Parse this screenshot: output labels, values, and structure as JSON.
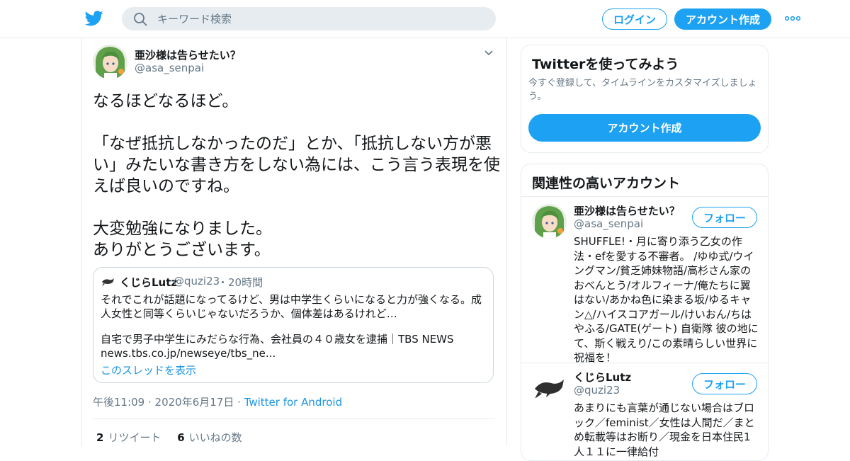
{
  "header": {
    "search_placeholder": "キーワード検索",
    "login_label": "ログイン",
    "signup_label": "アカウント作成",
    "brand_color": "#1da1f2"
  },
  "tweet": {
    "name": "亜沙様は告らせたい？",
    "handle": "@asa_senpai",
    "paragraphs": [
      "なるほどなるほど。",
      "「なぜ抵抗しなかったのだ」とか、「抵抗しない方が悪い」みたいな書き方をしない為には、こう言う表現を使えば良いのですね。",
      "大変勉強になりました。\nありがとうございます。"
    ],
    "quote": {
      "name": "くじらLutz",
      "handle": "@quzi23",
      "time": "・20時間",
      "text1": "それでこれが話題になってるけど、男は中学生くらいになると力が強くなる。成人女性と同等くらいじゃないだろうか、個体差はあるけれど…",
      "text2": "自宅で男子中学生にみだらな行為、会社員の４０歳女を逮捕｜TBS NEWS",
      "text3": "news.tbs.co.jp/newseye/tbs_ne...",
      "thread_link": "このスレッドを表示"
    },
    "time": "午後11:09",
    "date": "2020年6月17日",
    "source": "Twitter for Android",
    "retweets_count": "2",
    "retweets_label": "リツイート",
    "likes_count": "6",
    "likes_label": "いいねの数"
  },
  "signup_card": {
    "title": "Twitterを使ってみよう",
    "subtitle": "今すぐ登録して、タイムラインをカスタマイズしましょう。",
    "button": "アカウント作成"
  },
  "related": {
    "title": "関連性の高いアカウント",
    "follow_label": "フォロー",
    "accounts": [
      {
        "name": "亜沙様は告らせたい？",
        "handle": "@asa_senpai",
        "bio": "SHUFFLE!・月に寄り添う乙女の作法・efを愛する不審者。 /ゆゆ式/ウイングマン/貧乏姉妹物語/高杉さん家のおべんとう/オルフィーナ/俺たちに翼はない/あかね色に染まる坂/ゆるキャン△/ハイスコアガール/けいおん/ちはやふる/GATE(ゲート) 自衛隊 彼の地にて、斯く戦えり/この素晴らしい世界に祝福を！"
      },
      {
        "name": "くじらLutz",
        "handle": "@quzi23",
        "bio": "あまりにも言葉が通じない場合はブロック／feminist／女性は人間だ／まとめ転載等はお断り／現金を日本住民1人１１に一律給付"
      }
    ]
  }
}
